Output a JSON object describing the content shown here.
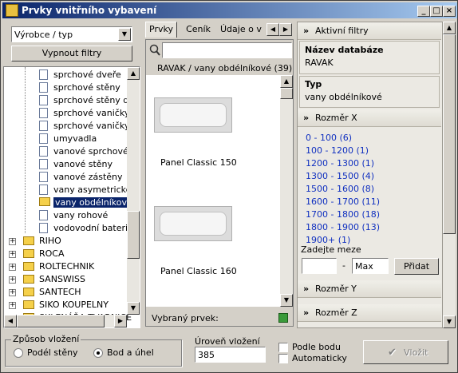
{
  "window": {
    "title": "Prvky vnitřního vybavení",
    "buttons": [
      "_",
      "□",
      "×"
    ]
  },
  "left": {
    "filter_select": "Výrobce / typ",
    "reset_button": "Vypnout filtry",
    "tree_items": [
      "sprchové dveře",
      "sprchové stěny",
      "sprchové stěny děli",
      "sprchové vaničky",
      "sprchové vaničky s",
      "umyvadla",
      "vanové sprchové d",
      "vanové stěny",
      "vanové zástěny",
      "vany asymetrické",
      "vany obdélníkové",
      "vany rohové",
      "vodovodní baterie"
    ],
    "selected_item": "vany obdélníkové",
    "folders": [
      "RIHO",
      "ROCA",
      "ROLTECHNIK",
      "SANSWISS",
      "SANTECH",
      "SIKO KOUPELNY",
      "SKLENÁŘA TVARNICE"
    ]
  },
  "middle": {
    "tabs": [
      "Prvky",
      "Ceník",
      "Údaje o v"
    ],
    "search_placeholder": "",
    "header": "RAVAK / vany obdélníkové (39)",
    "items": [
      {
        "name": "Panel Classic 150"
      },
      {
        "name": "Panel Classic 160"
      }
    ],
    "selected_label": "Vybraný prvek:"
  },
  "right": {
    "active_filters": "Aktivní filtry",
    "db_title": "Název databáze",
    "db_value": "RAVAK",
    "type_title": "Typ",
    "type_value": "vany obdélníkové",
    "size_x": "Rozměr X",
    "ranges": [
      "0 - 100  (6)",
      "100 - 1200  (1)",
      "1200 - 1300  (1)",
      "1300 - 1500  (4)",
      "1500 - 1600  (8)",
      "1600 - 1700  (11)",
      "1700 - 1800  (18)",
      "1800 - 1900  (13)",
      "1900+  (1)"
    ],
    "limits_label": "Zadejte meze",
    "min_value": "",
    "dash": "-",
    "max_value": "Max",
    "add_button": "Přidat",
    "size_y": "Rozměr Y",
    "size_z": "Rozměr Z"
  },
  "bottom": {
    "mode_group": "Způsob vložení",
    "mode_options": [
      "Podél stěny",
      "Bod a úhel"
    ],
    "mode_selected": "Bod a úhel",
    "level_label": "Úroveň vložení",
    "level_value": "385",
    "check_point": "Podle bodu",
    "check_auto": "Automaticky",
    "insert_button": "Vložit"
  }
}
